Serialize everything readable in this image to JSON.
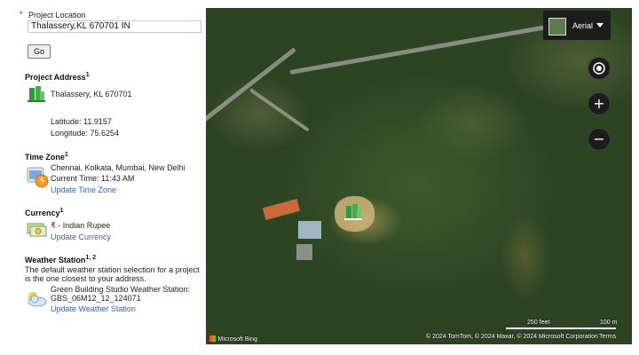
{
  "location": {
    "required_marker": "*",
    "label": "Project Location",
    "value": "Thalassery,KL 670701 IN",
    "go_label": "Go"
  },
  "address": {
    "heading": "Project Address",
    "sup": "1",
    "line": "Thalassery, KL 670701",
    "latitude": "Latitude: 11.9157",
    "longitude": "Longitude: 75.6254",
    "icon": "building-icon"
  },
  "timezone": {
    "heading": "Time Zone",
    "sup": "1",
    "zones": "Chennai, Kolkata, Mumbai, New Delhi",
    "current_time": "Current Time: 11:43 AM",
    "update_link": "Update Time Zone",
    "icon": "clock-icon"
  },
  "currency": {
    "heading": "Currency",
    "sup": "1",
    "value": "₹ - Indian Rupee",
    "update_link": "Update Currency",
    "icon": "money-icon"
  },
  "weather": {
    "heading": "Weather Station",
    "sup": "1, 2",
    "description": "The default weather station selection for a project is the one closest to your address.",
    "station_line1": "Green Building Studio Weather Station:",
    "station_line2": "GBS_06M12_12_124071",
    "update_link": "Update Weather Station",
    "icon": "weather-cloud-icon"
  },
  "map": {
    "type_label": "Aerial",
    "scale_feet": "250 feet",
    "scale_m": "100 m",
    "brand": "Microsoft Bing",
    "copyright": "© 2024 TomTom, © 2024 Maxar, © 2024 Microsoft Corporation",
    "terms": "Terms"
  },
  "colors": {
    "link": "#3a62a8",
    "required": "#cc0000",
    "map_control_bg": "#1c1c1c"
  }
}
